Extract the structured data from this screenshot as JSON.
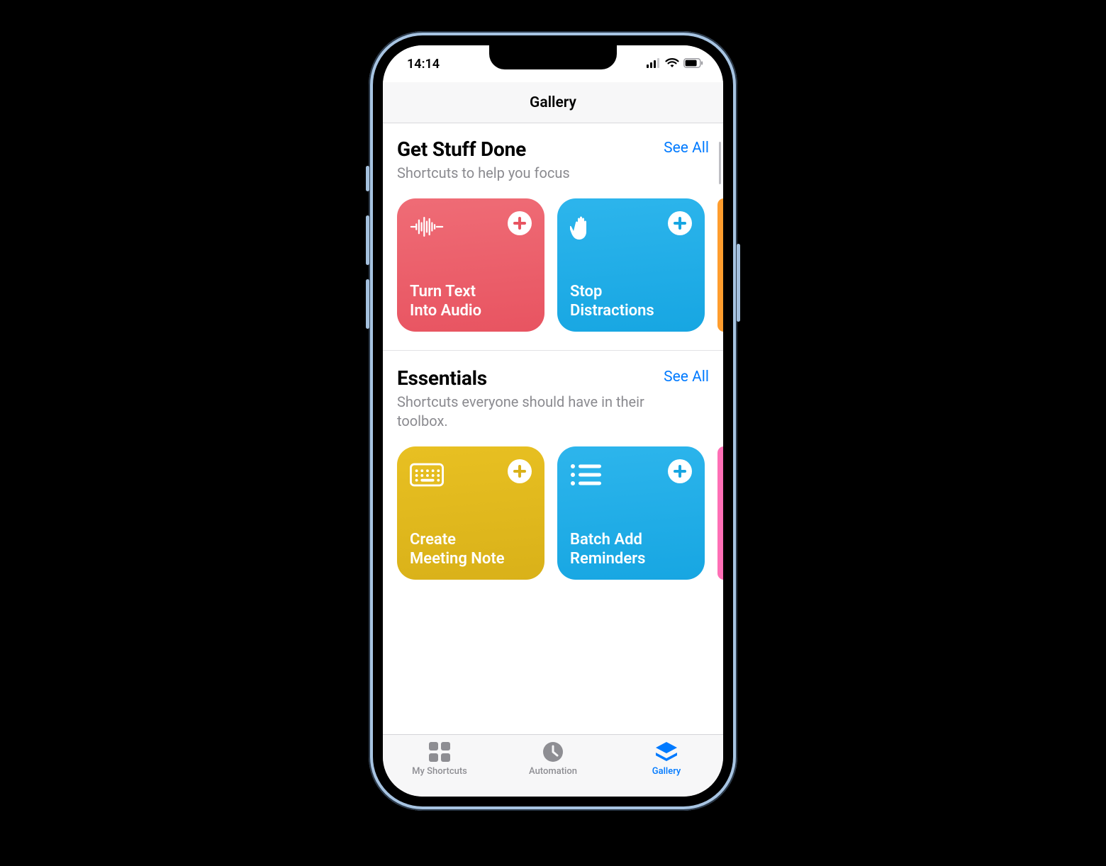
{
  "statusbar": {
    "time": "14:14"
  },
  "header": {
    "title": "Gallery"
  },
  "see_all_label": "See All",
  "sections": [
    {
      "title": "Get Stuff Done",
      "subtitle": "Shortcuts to help you focus",
      "cards": [
        {
          "label": "Turn Text\nInto Audio",
          "icon": "waveform",
          "color": "red"
        },
        {
          "label": "Stop\nDistractions",
          "icon": "hand",
          "color": "blue"
        },
        {
          "label": "",
          "icon": "",
          "color": "orange",
          "peek": true
        }
      ]
    },
    {
      "title": "Essentials",
      "subtitle": "Shortcuts everyone should have in their toolbox.",
      "cards": [
        {
          "label": "Create\nMeeting Note",
          "icon": "keyboard",
          "color": "yellow"
        },
        {
          "label": "Batch Add\nReminders",
          "icon": "list",
          "color": "blue"
        },
        {
          "label": "",
          "icon": "",
          "color": "pink",
          "peek": true
        }
      ]
    }
  ],
  "tabs": [
    {
      "label": "My Shortcuts",
      "icon": "grid",
      "active": false
    },
    {
      "label": "Automation",
      "icon": "clock",
      "active": false
    },
    {
      "label": "Gallery",
      "icon": "stack",
      "active": true
    }
  ],
  "colors": {
    "accent": "#007aff"
  }
}
